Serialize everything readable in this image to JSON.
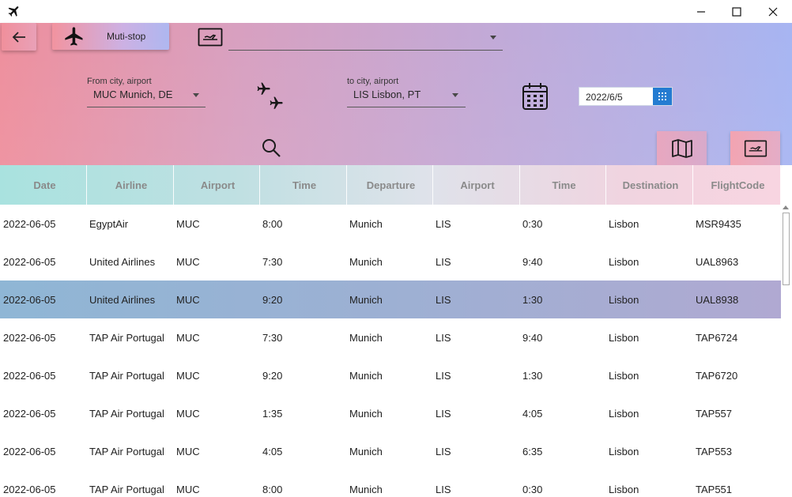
{
  "window": {
    "controls": {
      "minimize": "minimize-icon",
      "maximize": "maximize-icon",
      "close": "close-icon"
    }
  },
  "toolbar": {
    "multistop_label": "Muti-stop",
    "ticket_selector_value": ""
  },
  "search": {
    "from_hint": "From city, airport",
    "from_value": "MUC Munich, DE",
    "to_hint": "to city, airport",
    "to_value": "LIS Lisbon, PT",
    "date_value": "2022/6/5"
  },
  "colors": {
    "header_gradient_left": "#ee8f9d",
    "header_gradient_right": "#a7b5f2",
    "selected_row": "#9db0d3",
    "date_button": "#1e78d0"
  },
  "table": {
    "headers": [
      "Date",
      "Airline",
      "Airport",
      "Time",
      "Departure",
      "Airport",
      "Time",
      "Destination",
      "FlightCode"
    ],
    "selected_index": 2,
    "rows": [
      [
        "2022-06-05",
        "EgyptAir",
        "MUC",
        "8:00",
        "Munich",
        "LIS",
        "0:30",
        "Lisbon",
        "MSR9435"
      ],
      [
        "2022-06-05",
        "United Airlines",
        "MUC",
        "7:30",
        "Munich",
        "LIS",
        "9:40",
        "Lisbon",
        "UAL8963"
      ],
      [
        "2022-06-05",
        "United Airlines",
        "MUC",
        "9:20",
        "Munich",
        "LIS",
        "1:30",
        "Lisbon",
        "UAL8938"
      ],
      [
        "2022-06-05",
        "TAP Air Portugal",
        "MUC",
        "7:30",
        "Munich",
        "LIS",
        "9:40",
        "Lisbon",
        "TAP6724"
      ],
      [
        "2022-06-05",
        "TAP Air Portugal",
        "MUC",
        "9:20",
        "Munich",
        "LIS",
        "1:30",
        "Lisbon",
        "TAP6720"
      ],
      [
        "2022-06-05",
        "TAP Air Portugal",
        "MUC",
        "1:35",
        "Munich",
        "LIS",
        "4:05",
        "Lisbon",
        "TAP557"
      ],
      [
        "2022-06-05",
        "TAP Air Portugal",
        "MUC",
        "4:05",
        "Munich",
        "LIS",
        "6:35",
        "Lisbon",
        "TAP553"
      ],
      [
        "2022-06-05",
        "TAP Air Portugal",
        "MUC",
        "8:00",
        "Munich",
        "LIS",
        "0:30",
        "Lisbon",
        "TAP551"
      ]
    ]
  }
}
